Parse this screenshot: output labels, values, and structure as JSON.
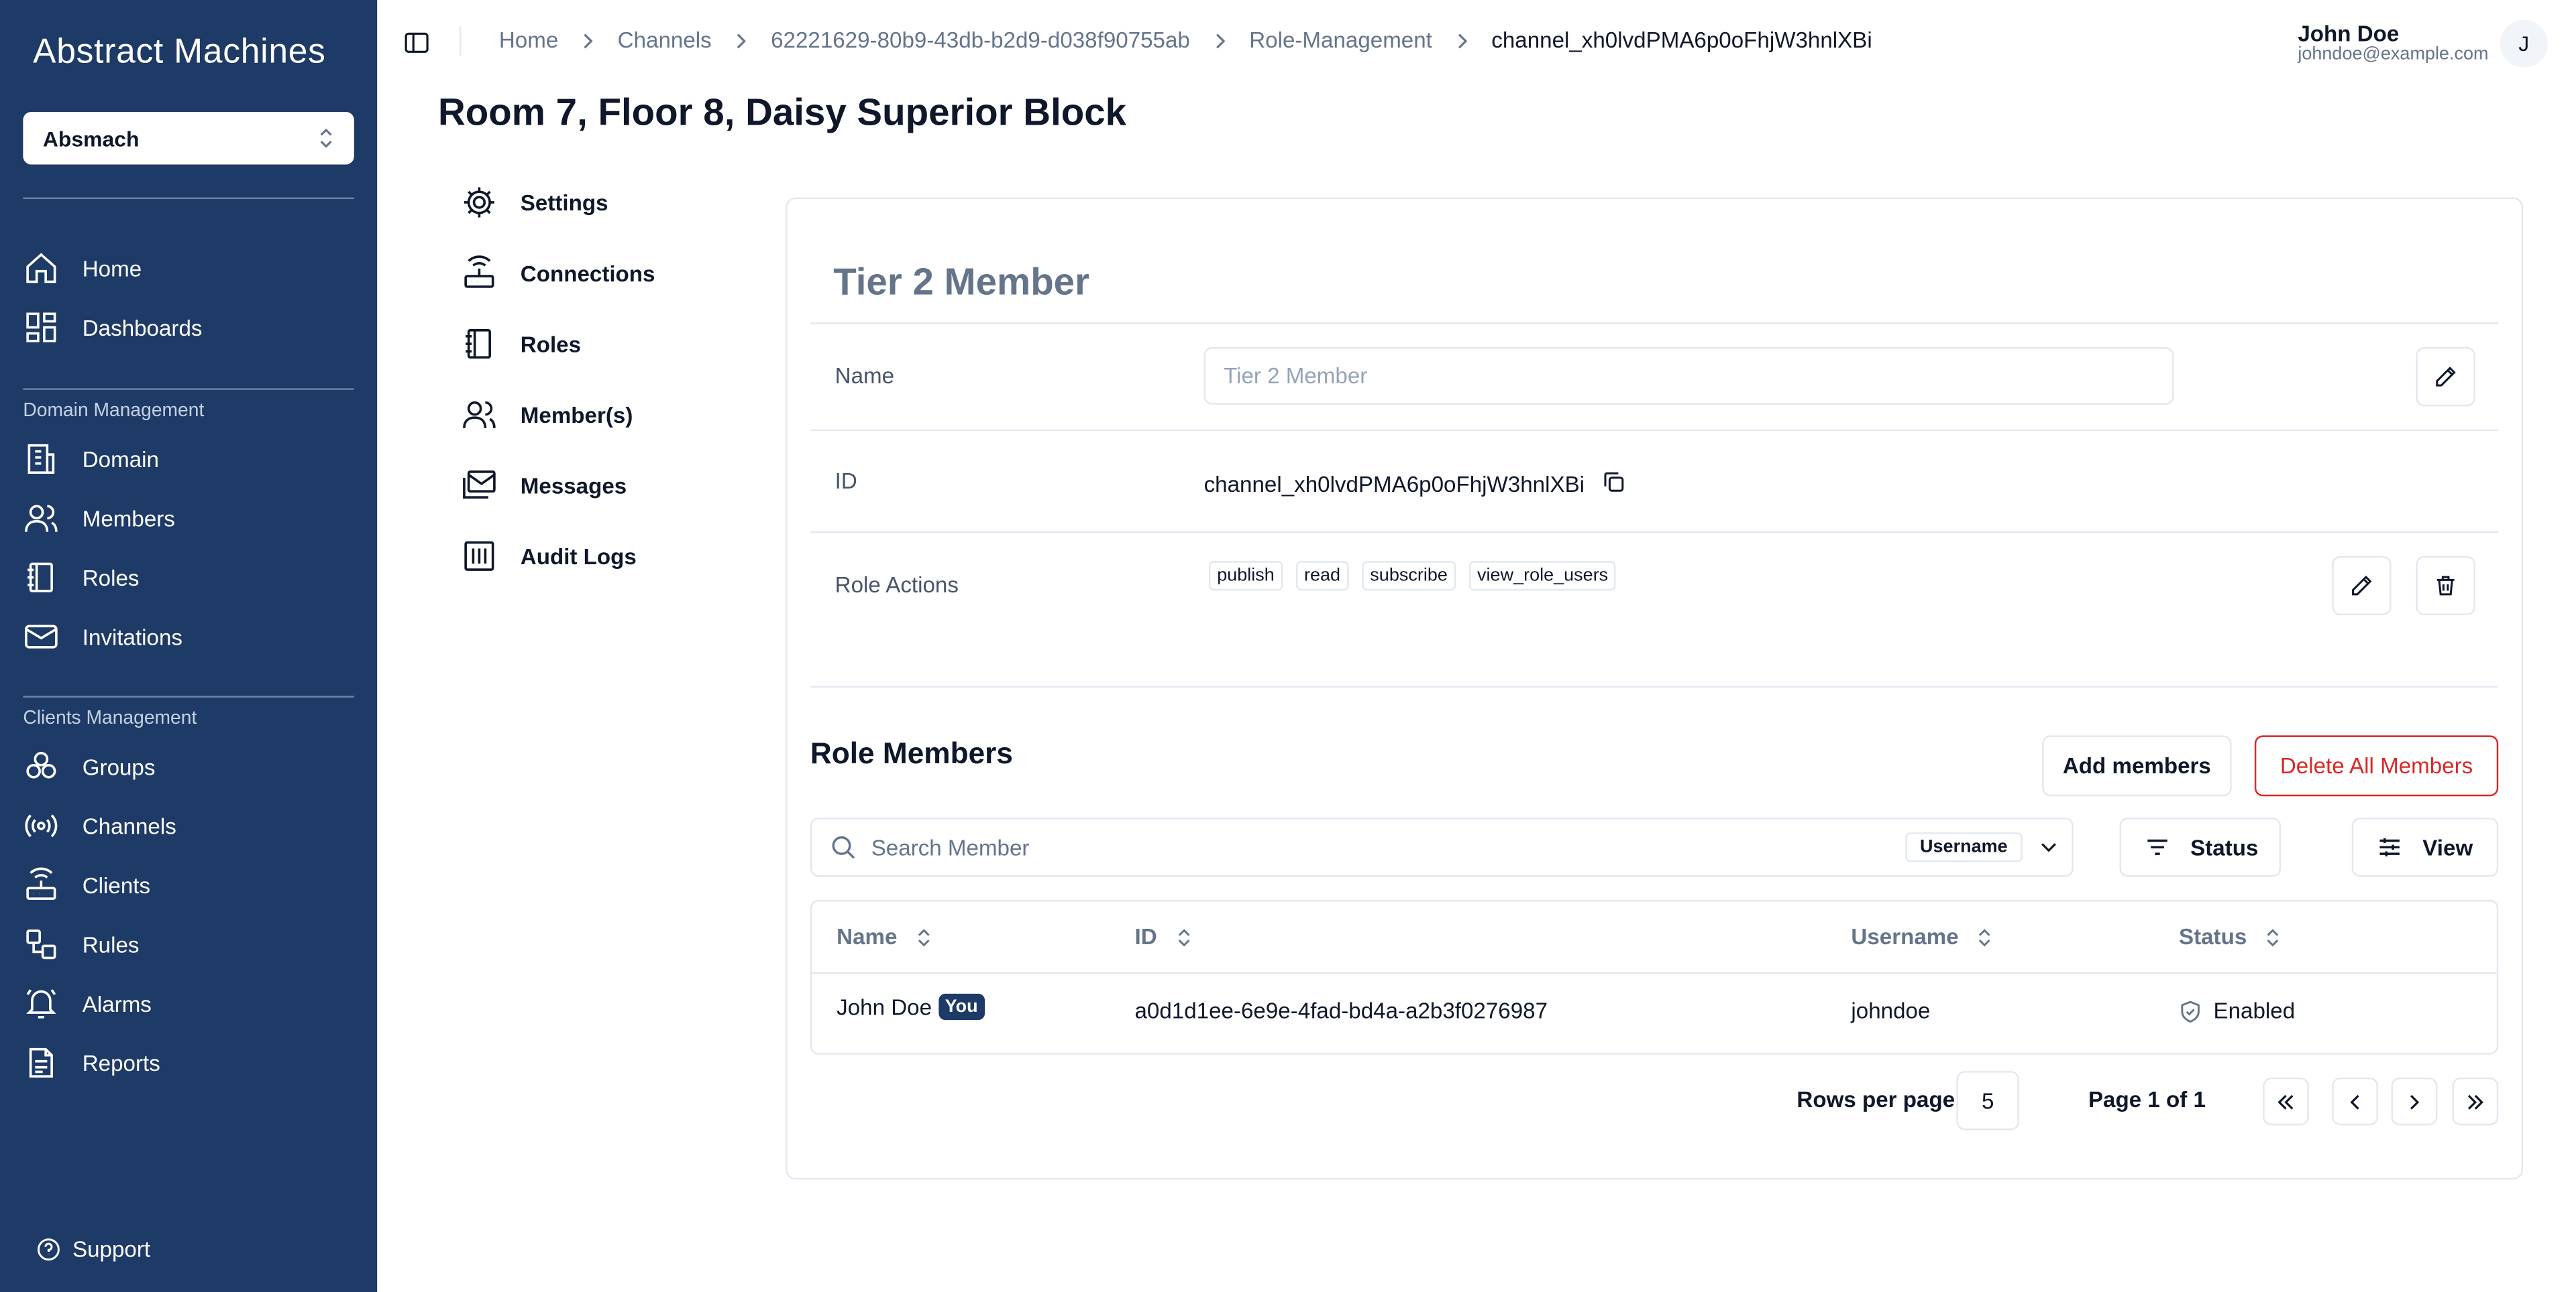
{
  "app": {
    "logo": "Abstract Machines",
    "org_select": "Absmach",
    "support_label": "Support"
  },
  "sidebar": {
    "top_items": [
      {
        "label": "Home",
        "icon": "home-icon"
      },
      {
        "label": "Dashboards",
        "icon": "dashboard-icon"
      }
    ],
    "domain_group_label": "Domain Management",
    "domain_items": [
      {
        "label": "Domain",
        "icon": "building-icon"
      },
      {
        "label": "Members",
        "icon": "users-icon"
      },
      {
        "label": "Roles",
        "icon": "notebook-icon"
      },
      {
        "label": "Invitations",
        "icon": "mail-icon"
      }
    ],
    "clients_group_label": "Clients Management",
    "clients_items": [
      {
        "label": "Groups",
        "icon": "groups-icon"
      },
      {
        "label": "Channels",
        "icon": "radio-icon"
      },
      {
        "label": "Clients",
        "icon": "router-icon"
      },
      {
        "label": "Rules",
        "icon": "workflow-icon"
      },
      {
        "label": "Alarms",
        "icon": "bell-icon"
      },
      {
        "label": "Reports",
        "icon": "report-icon"
      }
    ]
  },
  "breadcrumb": [
    "Home",
    "Channels",
    "62221629-80b9-43db-b2d9-d038f90755ab",
    "Role-Management",
    "channel_xh0lvdPMA6p0oFhjW3hnlXBi"
  ],
  "user": {
    "name": "John Doe",
    "email": "johndoe@example.com",
    "avatar_initial": "J"
  },
  "page_title": "Room 7, Floor 8, Daisy Superior Block",
  "sub_nav": [
    {
      "label": "Settings",
      "icon": "gear-icon"
    },
    {
      "label": "Connections",
      "icon": "router-icon"
    },
    {
      "label": "Roles",
      "icon": "notebook-icon"
    },
    {
      "label": "Member(s)",
      "icon": "users-icon"
    },
    {
      "label": "Messages",
      "icon": "messages-icon"
    },
    {
      "label": "Audit Logs",
      "icon": "logs-icon"
    }
  ],
  "role": {
    "title": "Tier 2 Member",
    "name_label": "Name",
    "name_placeholder": "Tier 2 Member",
    "id_label": "ID",
    "id_value": "channel_xh0lvdPMA6p0oFhjW3hnlXBi",
    "actions_label": "Role Actions",
    "actions": [
      "publish",
      "read",
      "subscribe",
      "view_role_users"
    ]
  },
  "members": {
    "title": "Role Members",
    "add_button": "Add members",
    "delete_all_button": "Delete All Members",
    "search_placeholder": "Search Member",
    "search_field": "Username",
    "status_button": "Status",
    "view_button": "View",
    "columns": [
      "Name",
      "ID",
      "Username",
      "Status"
    ],
    "rows": [
      {
        "name": "John Doe",
        "badge": "You",
        "id": "a0d1d1ee-6e9e-4fad-bd4a-a2b3f0276987",
        "username": "johndoe",
        "status": "Enabled"
      }
    ],
    "rows_per_page_label": "Rows per page",
    "rows_per_page": "5",
    "page_label": "Page 1 of 1"
  },
  "colors": {
    "sidebar_bg": "#1e3a66",
    "danger": "#dc2626",
    "muted": "#64748b"
  }
}
